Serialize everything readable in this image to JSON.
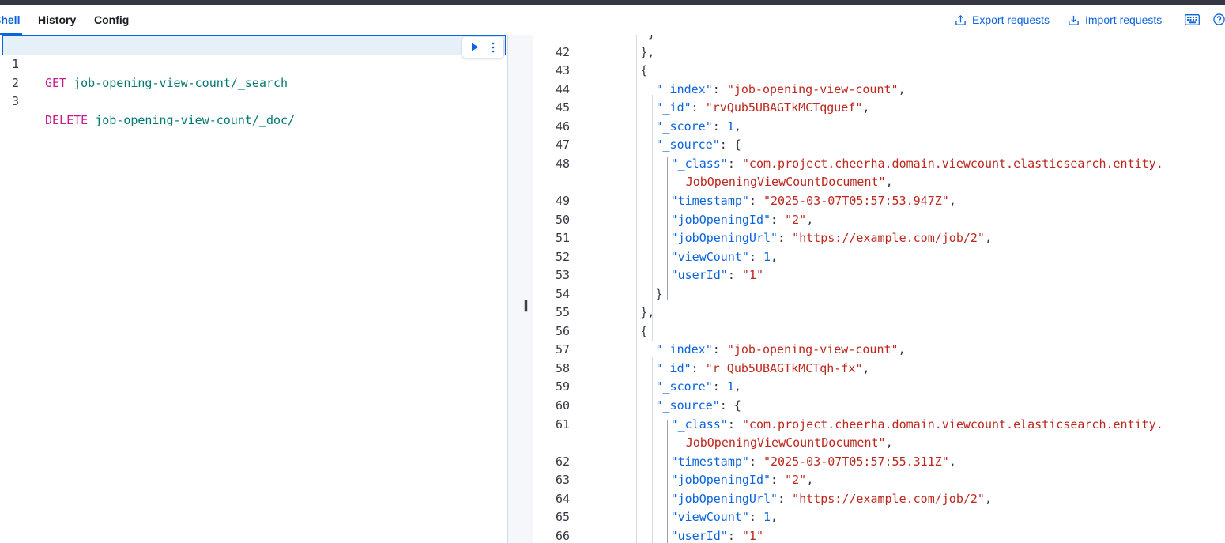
{
  "tabs": [
    {
      "label": "Shell",
      "active": true
    },
    {
      "label": "History",
      "active": false
    },
    {
      "label": "Config",
      "active": false
    }
  ],
  "actions": {
    "export_label": "Export requests",
    "import_label": "Import requests",
    "keyboard_icon": "keyboard-icon",
    "help_icon": "help-icon"
  },
  "editor": {
    "lines": [
      {
        "num": "1",
        "method": "GET",
        "path": "job-opening-view-count/_search"
      },
      {
        "num": "2",
        "method": "",
        "path": ""
      },
      {
        "num": "3",
        "method": "DELETE",
        "path": "job-opening-view-count/_doc/"
      }
    ],
    "run_icon": "play-icon",
    "more_icon": "vertical-dots-icon"
  },
  "output": {
    "lines": [
      {
        "num": "",
        "tokens": [
          [
            "p",
            "}"
          ]
        ],
        "indent": 9
      },
      {
        "num": "42",
        "tokens": [
          [
            "p",
            "},"
          ]
        ],
        "indent": 8
      },
      {
        "num": "43",
        "tokens": [
          [
            "p",
            "{"
          ]
        ],
        "indent": 8
      },
      {
        "num": "44",
        "tokens": [
          [
            "k",
            "\"_index\""
          ],
          [
            "p",
            ": "
          ],
          [
            "s",
            "\"job-opening-view-count\""
          ],
          [
            "p",
            ","
          ]
        ],
        "indent": 10
      },
      {
        "num": "45",
        "tokens": [
          [
            "k",
            "\"_id\""
          ],
          [
            "p",
            ": "
          ],
          [
            "s",
            "\"rvQub5UBAGTkMCTqguef\""
          ],
          [
            "p",
            ","
          ]
        ],
        "indent": 10
      },
      {
        "num": "46",
        "tokens": [
          [
            "k",
            "\"_score\""
          ],
          [
            "p",
            ": "
          ],
          [
            "n",
            "1"
          ],
          [
            "p",
            ","
          ]
        ],
        "indent": 10
      },
      {
        "num": "47",
        "tokens": [
          [
            "k",
            "\"_source\""
          ],
          [
            "p",
            ": {"
          ]
        ],
        "indent": 10
      },
      {
        "num": "48",
        "tokens": [
          [
            "k",
            "\"_class\""
          ],
          [
            "p",
            ": "
          ],
          [
            "s",
            "\"com.project.cheerha.domain.viewcount.elasticsearch.entity."
          ]
        ],
        "indent": 12
      },
      {
        "num": "",
        "tokens": [
          [
            "s",
            "JobOpeningViewCountDocument\""
          ],
          [
            "p",
            ","
          ]
        ],
        "indent": 14
      },
      {
        "num": "49",
        "tokens": [
          [
            "k",
            "\"timestamp\""
          ],
          [
            "p",
            ": "
          ],
          [
            "s",
            "\"2025-03-07T05:57:53.947Z\""
          ],
          [
            "p",
            ","
          ]
        ],
        "indent": 12
      },
      {
        "num": "50",
        "tokens": [
          [
            "k",
            "\"jobOpeningId\""
          ],
          [
            "p",
            ": "
          ],
          [
            "s",
            "\"2\""
          ],
          [
            "p",
            ","
          ]
        ],
        "indent": 12
      },
      {
        "num": "51",
        "tokens": [
          [
            "k",
            "\"jobOpeningUrl\""
          ],
          [
            "p",
            ": "
          ],
          [
            "s",
            "\"https://example.com/job/2\""
          ],
          [
            "p",
            ","
          ]
        ],
        "indent": 12
      },
      {
        "num": "52",
        "tokens": [
          [
            "k",
            "\"viewCount\""
          ],
          [
            "p",
            ": "
          ],
          [
            "n",
            "1"
          ],
          [
            "p",
            ","
          ]
        ],
        "indent": 12
      },
      {
        "num": "53",
        "tokens": [
          [
            "k",
            "\"userId\""
          ],
          [
            "p",
            ": "
          ],
          [
            "s",
            "\"1\""
          ]
        ],
        "indent": 12
      },
      {
        "num": "54",
        "tokens": [
          [
            "p",
            "}"
          ]
        ],
        "indent": 10
      },
      {
        "num": "55",
        "tokens": [
          [
            "p",
            "},"
          ]
        ],
        "indent": 8
      },
      {
        "num": "56",
        "tokens": [
          [
            "p",
            "{"
          ]
        ],
        "indent": 8
      },
      {
        "num": "57",
        "tokens": [
          [
            "k",
            "\"_index\""
          ],
          [
            "p",
            ": "
          ],
          [
            "s",
            "\"job-opening-view-count\""
          ],
          [
            "p",
            ","
          ]
        ],
        "indent": 10
      },
      {
        "num": "58",
        "tokens": [
          [
            "k",
            "\"_id\""
          ],
          [
            "p",
            ": "
          ],
          [
            "s",
            "\"r_Qub5UBAGTkMCTqh-fx\""
          ],
          [
            "p",
            ","
          ]
        ],
        "indent": 10
      },
      {
        "num": "59",
        "tokens": [
          [
            "k",
            "\"_score\""
          ],
          [
            "p",
            ": "
          ],
          [
            "n",
            "1"
          ],
          [
            "p",
            ","
          ]
        ],
        "indent": 10
      },
      {
        "num": "60",
        "tokens": [
          [
            "k",
            "\"_source\""
          ],
          [
            "p",
            ": {"
          ]
        ],
        "indent": 10
      },
      {
        "num": "61",
        "tokens": [
          [
            "k",
            "\"_class\""
          ],
          [
            "p",
            ": "
          ],
          [
            "s",
            "\"com.project.cheerha.domain.viewcount.elasticsearch.entity."
          ]
        ],
        "indent": 12
      },
      {
        "num": "",
        "tokens": [
          [
            "s",
            "JobOpeningViewCountDocument\""
          ],
          [
            "p",
            ","
          ]
        ],
        "indent": 14
      },
      {
        "num": "62",
        "tokens": [
          [
            "k",
            "\"timestamp\""
          ],
          [
            "p",
            ": "
          ],
          [
            "s",
            "\"2025-03-07T05:57:55.311Z\""
          ],
          [
            "p",
            ","
          ]
        ],
        "indent": 12
      },
      {
        "num": "63",
        "tokens": [
          [
            "k",
            "\"jobOpeningId\""
          ],
          [
            "p",
            ": "
          ],
          [
            "s",
            "\"2\""
          ],
          [
            "p",
            ","
          ]
        ],
        "indent": 12
      },
      {
        "num": "64",
        "tokens": [
          [
            "k",
            "\"jobOpeningUrl\""
          ],
          [
            "p",
            ": "
          ],
          [
            "s",
            "\"https://example.com/job/2\""
          ],
          [
            "p",
            ","
          ]
        ],
        "indent": 12
      },
      {
        "num": "65",
        "tokens": [
          [
            "k",
            "\"viewCount\""
          ],
          [
            "p",
            ": "
          ],
          [
            "n",
            "1"
          ],
          [
            "p",
            ","
          ]
        ],
        "indent": 12
      },
      {
        "num": "66",
        "tokens": [
          [
            "k",
            "\"userId\""
          ],
          [
            "p",
            ": "
          ],
          [
            "s",
            "\"1\""
          ]
        ],
        "indent": 12
      }
    ]
  },
  "colors": {
    "accent": "#0b64dd",
    "json_key": "#0b64dd",
    "json_string": "#bd271e",
    "method": "#c61e8c",
    "request_path": "#007871"
  }
}
